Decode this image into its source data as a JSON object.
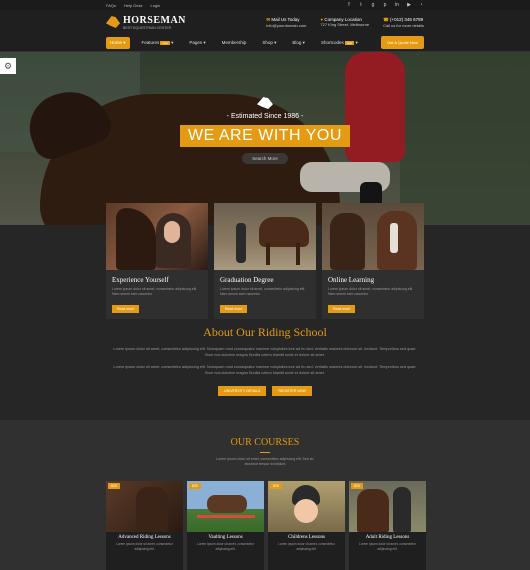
{
  "topbar": {
    "links": [
      "FAQs",
      "Help Desk",
      "Login"
    ],
    "social_icons": [
      "facebook-icon",
      "twitter-icon",
      "google-plus-icon",
      "pinterest-icon",
      "linkedin-icon",
      "youtube-icon",
      "rss-icon"
    ]
  },
  "header": {
    "brand": "HORSEMAN",
    "tagline": "BEST EQUESTRIAN CENTER",
    "mail_label": "Mail Us Today",
    "mail_value": "info@yourdomain.com",
    "location_label": "Company Location",
    "location_value": "727 King Street, Melbourne",
    "phone_label": "(+012) 345 6789",
    "phone_value": "Call us for more details"
  },
  "nav": {
    "items": [
      "Home",
      "Features",
      "Pages",
      "Membership",
      "Shop",
      "Blog",
      "Shortcodes"
    ],
    "features_badge": "new",
    "shortcodes_badge": "new",
    "quote_button": "Get A Quote Now"
  },
  "hero": {
    "established": "- Estimated Since 1986 -",
    "headline": "WE ARE WITH YOU",
    "search_button": "Search More"
  },
  "cards": [
    {
      "title": "Experience Yourself",
      "text": "Lorem ipsum dolor sit amet, consectetur adipiscing elit. Nam semm sem nascetur",
      "button": "Read more"
    },
    {
      "title": "Graduation Degree",
      "text": "Lorem ipsum dolor sit amet, consectetur adipiscing elit. Nam semm sem nascetur",
      "button": "Read more"
    },
    {
      "title": "Online Learning",
      "text": "Lorem ipsum dolor sit amet, consectetur adipiscing elit. Nam semm sem nascetur",
      "button": "Read more"
    }
  ],
  "about": {
    "title": "About Our Riding School",
    "para1": "Lorem ipsum dolor sit amet, consectetur adipiscing elit. Numquam mod consequatur maxime voluptates iure ad iru sed. veritatis maiores dolorum sit, incidunt. Temporibus sed quae. Illum nos dolorem magna Sunilla cetero blandit unde et dolore sit amet.",
    "para2": "Lorem ipsum dolor sit amet, consectetur adipiscing elit. Numquam mod consequatur maxime voluptates iure ad iru sed. veritatis maiores dolorum sit, incidunt. Temporibus sed quae. Illum nos dolorem magna Sunilla cetero blandit unde et dolore sit amet.",
    "button1": "UNIVERSITY DETAILS",
    "button2": "REGISTER NOW"
  },
  "courses": {
    "title": "OUR COURSES",
    "subtitle": "Lorem ipsum dolor sit amet, consectetur adipiscing elit. Sed do eiusmod tempor incididunt",
    "items": [
      {
        "price": "$25",
        "title": "Advanced Riding Lessons",
        "text": "Lorem ipsum dolor sit amet, consectetur adipiscing elit."
      },
      {
        "price": "$30",
        "title": "Vaulting Lessons",
        "text": "Lorem ipsum dolor sit amet, consectetur adipiscing elit."
      },
      {
        "price": "$25",
        "title": "Childrens Lessons",
        "text": "Lorem ipsum dolor sit amet, consectetur adipiscing elit."
      },
      {
        "price": "$25",
        "title": "Adult Riding Lessons",
        "text": "Lorem ipsum dolor sit amet, consectetur adipiscing elit."
      }
    ]
  },
  "colors": {
    "accent": "#e49a12",
    "background": "#262626"
  }
}
